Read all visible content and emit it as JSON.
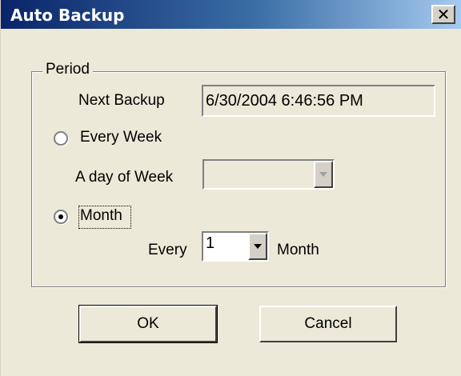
{
  "window": {
    "title": "Auto Backup",
    "close_glyph": "✕"
  },
  "period": {
    "group_label": "Period",
    "next_backup_label": "Next Backup",
    "next_backup_value": "6/30/2004 6:46:56 PM",
    "every_week_label": "Every Week",
    "every_week_selected": false,
    "day_of_week_label": "A day of Week",
    "day_of_week_value": "",
    "month_label": "Month",
    "month_selected": true,
    "every_label": "Every",
    "every_value": "1",
    "month_unit_label": "Month"
  },
  "buttons": {
    "ok": "OK",
    "cancel": "Cancel"
  },
  "icons": {
    "close": "close-icon",
    "dropdown": "chevron-down-icon"
  }
}
